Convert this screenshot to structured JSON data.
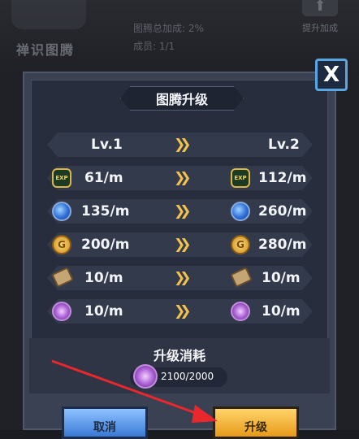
{
  "background": {
    "emblem_label": "禅识图腾",
    "lines": [
      "图腾总加成: 2%",
      "成员: 1/1"
    ],
    "upgrade_button_label": "提升加成"
  },
  "dialog": {
    "title": "图腾升级",
    "close_label": "X",
    "level_row": {
      "left": "Lv.1",
      "right": "Lv.2"
    },
    "stat_rows": [
      {
        "icon": "exp-icon",
        "left": "61/m",
        "right": "112/m"
      },
      {
        "icon": "blue-orb-icon",
        "left": "135/m",
        "right": "260/m"
      },
      {
        "icon": "gold-coin-icon",
        "left": "200/m",
        "right": "280/m"
      },
      {
        "icon": "scroll-icon",
        "left": "10/m",
        "right": "10/m"
      },
      {
        "icon": "purple-swirl-icon",
        "left": "10/m",
        "right": "10/m"
      }
    ],
    "cost": {
      "title": "升级消耗",
      "value": "2100/2000",
      "icon": "purple-swirl-icon"
    },
    "buttons": {
      "cancel": "取消",
      "upgrade": "升级"
    }
  },
  "colors": {
    "accent": "#f2c14e",
    "cancel_button": "#3a79d6",
    "upgrade_button": "#e79a1a",
    "arrow": "#e8282d"
  }
}
